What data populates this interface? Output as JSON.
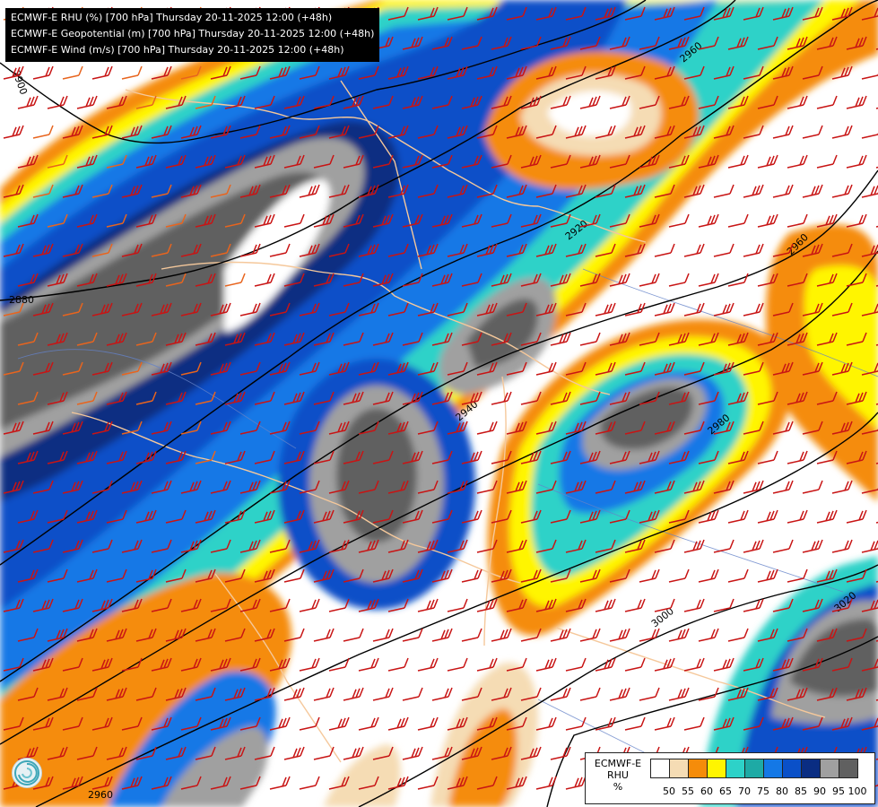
{
  "header": {
    "lines": [
      "ECMWF-E RHU (%) [700 hPa] Thursday 20-11-2025 12:00 (+48h)",
      "ECMWF-E Geopotential (m) [700 hPa] Thursday 20-11-2025 12:00 (+48h)",
      "ECMWF-E Wind (m/s) [700 hPa] Thursday 20-11-2025 12:00 (+48h)"
    ]
  },
  "legend": {
    "title_lines": [
      "ECMWF-E",
      "RHU",
      "%"
    ],
    "ticks": [
      "50",
      "55",
      "60",
      "65",
      "70",
      "75",
      "80",
      "85",
      "90",
      "95",
      "100"
    ],
    "colors": [
      "#ffffff",
      "#f5dcb4",
      "#f58c0a",
      "#fff500",
      "#2dd2c8",
      "#1eaaa5",
      "#1478e6",
      "#0a50c8",
      "#0a2d82",
      "#a0a0a0",
      "#606060"
    ]
  },
  "contours": {
    "labels": [
      "2880",
      "2920",
      "2940",
      "2960",
      "2980",
      "2960",
      "3000",
      "3020",
      "2960",
      "2900"
    ]
  },
  "colors": {
    "contour_line": "#000000",
    "wind_barb": "#c81414",
    "wind_barb_secondary": "#e8641e",
    "border": "#f5c89b",
    "river": "#6482c8"
  },
  "icons": {
    "logo": "weather-service-logo-icon"
  }
}
